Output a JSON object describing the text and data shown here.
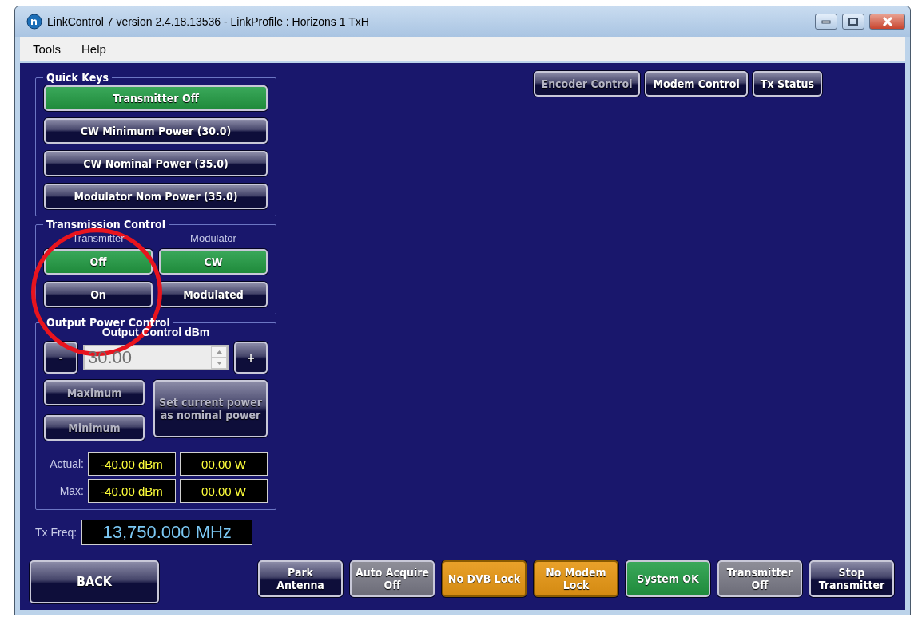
{
  "window": {
    "title": "LinkControl 7 version 2.4.18.13536 - LinkProfile : Horizons 1 TxH"
  },
  "menu": [
    "Tools",
    "Help"
  ],
  "quick_keys": {
    "title": "Quick Keys",
    "buttons": [
      {
        "label": "Transmitter Off",
        "selected": true
      },
      {
        "label": "CW Minimum Power (30.0)",
        "selected": false
      },
      {
        "label": "CW Nominal Power (35.0)",
        "selected": false
      },
      {
        "label": "Modulator Nom Power (35.0)",
        "selected": false
      }
    ]
  },
  "transmission_control": {
    "title": "Transmission Control",
    "columns": [
      {
        "heading": "Transmitter",
        "buttons": [
          {
            "label": "Off",
            "selected": true
          },
          {
            "label": "On",
            "selected": false
          }
        ]
      },
      {
        "heading": "Modulator",
        "buttons": [
          {
            "label": "CW",
            "selected": true
          },
          {
            "label": "Modulated",
            "selected": false
          }
        ]
      }
    ]
  },
  "output_power_control": {
    "title": "Output Power Control",
    "subtitle": "Output Control dBm",
    "decrement": {
      "label": "-",
      "disabled": true
    },
    "value": "30.00",
    "increment": {
      "label": "+",
      "disabled": false
    },
    "maximum": {
      "label": "Maximum",
      "disabled": true
    },
    "minimum": {
      "label": "Minimum",
      "disabled": true
    },
    "set_nominal": {
      "label": "Set current power as nominal power",
      "disabled": true
    },
    "readings": [
      {
        "label": "Actual:",
        "dbm": "-40.00 dBm",
        "watts": "00.00 W"
      },
      {
        "label": "Max:",
        "dbm": "-40.00 dBm",
        "watts": "00.00 W"
      }
    ]
  },
  "tx_freq": {
    "label": "Tx Freq:",
    "value": "13,750.000 MHz"
  },
  "top_buttons": [
    {
      "label": "Encoder Control",
      "disabled": true
    },
    {
      "label": "Modem Control",
      "disabled": false
    },
    {
      "label": "Tx Status",
      "disabled": false
    }
  ],
  "back_button": "BACK",
  "status_buttons": [
    {
      "label": "Park Antenna",
      "kind": "dark"
    },
    {
      "label": "Auto Acquire Off",
      "kind": "grey"
    },
    {
      "label": "No DVB Lock",
      "kind": "orange"
    },
    {
      "label": "No Modem Lock",
      "kind": "orange"
    },
    {
      "label": "System OK",
      "kind": "green"
    },
    {
      "label": "Transmitter Off",
      "kind": "grey"
    },
    {
      "label": "Stop Transmitter",
      "kind": "dark"
    }
  ]
}
